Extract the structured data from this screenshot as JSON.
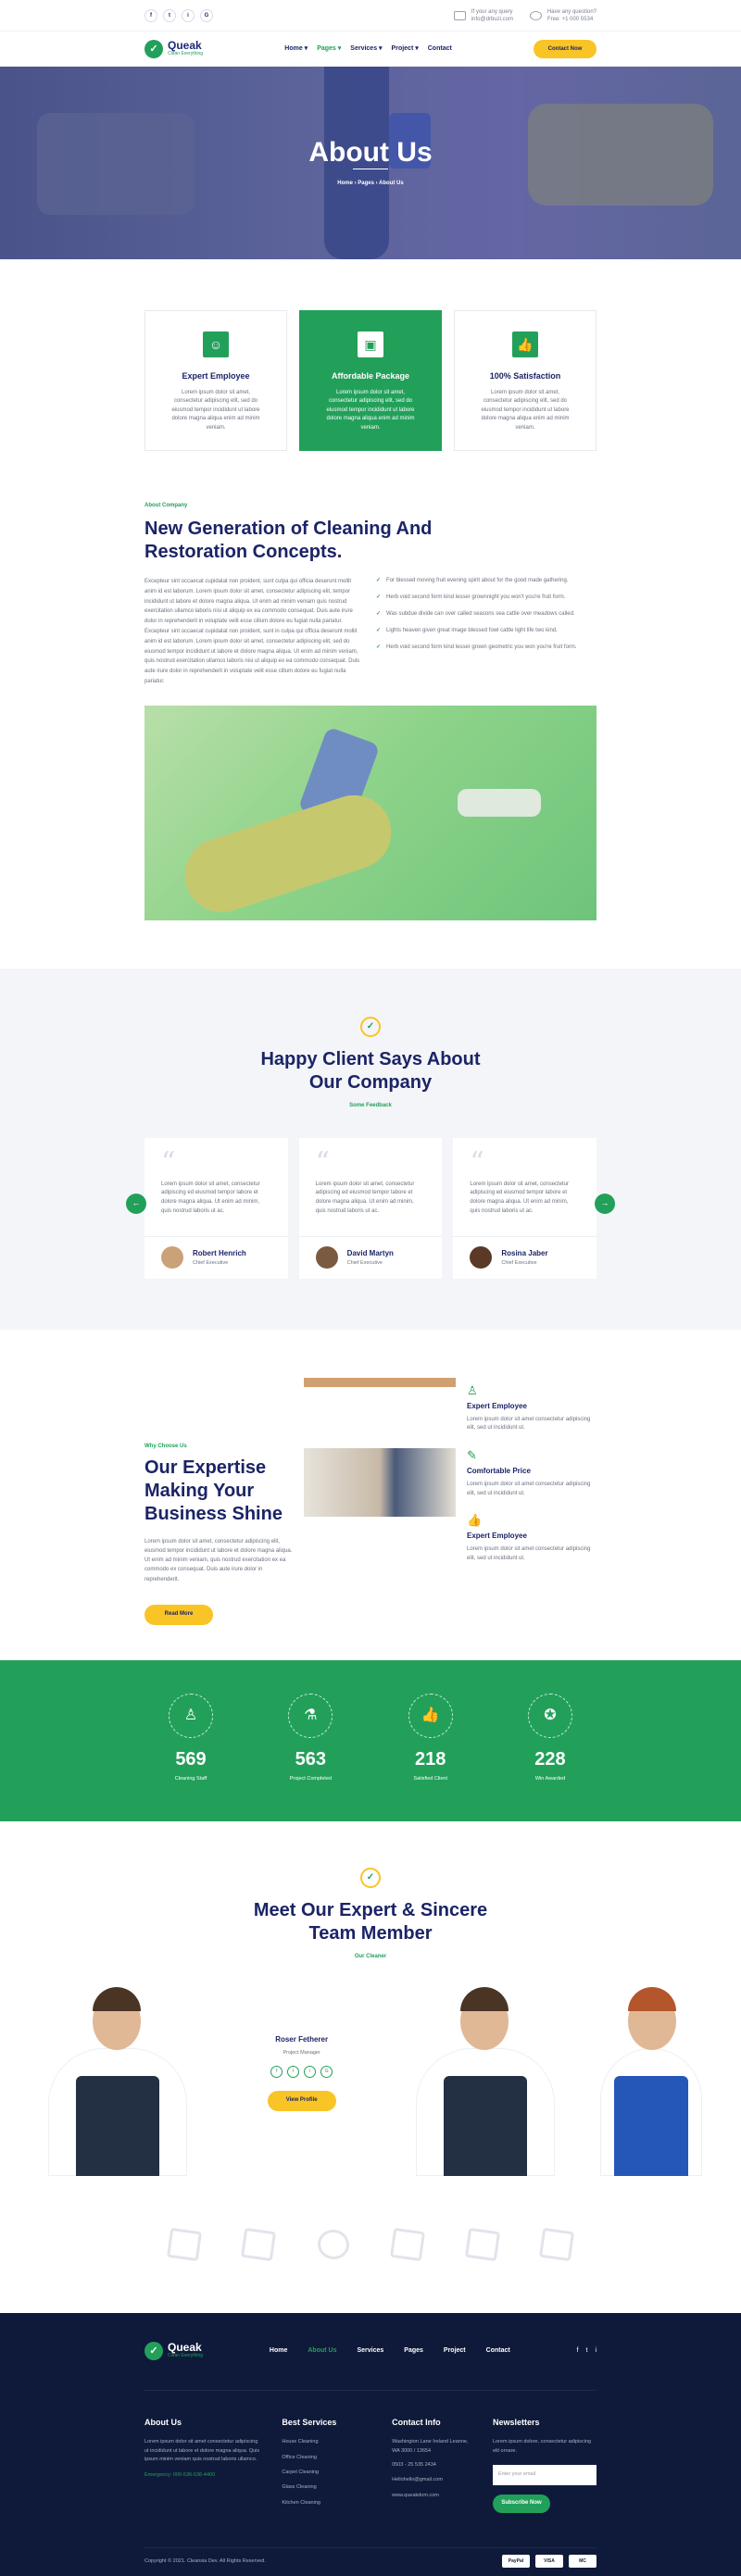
{
  "topbar": {
    "socials": [
      "f",
      "t",
      "i",
      "G"
    ],
    "email_label": "If your any query",
    "email": "info@drbuzi.com",
    "phone_label": "Have any question?",
    "phone": "Free: +1 000 5534"
  },
  "brand": {
    "name": "Queak",
    "tagline": "Clean Everything"
  },
  "nav": {
    "items": [
      "Home ▾",
      "Pages ▾",
      "Services ▾",
      "Project ▾",
      "Contact"
    ],
    "cta": "Contact Now"
  },
  "hero": {
    "title": "About Us",
    "crumb": "Home  ›  Pages  ›  About Us"
  },
  "features": [
    {
      "title": "Expert Employee",
      "text": "Lorem ipsum dolor sit amet, consectetur adipiscing elit, sed do eiusmod tempor incididunt ut labore dolore magna aliqua enim ad minim veniam."
    },
    {
      "title": "Affordable Package",
      "text": "Lorem ipsum dolor sit amet, consectetur adipiscing elit, sed do eiusmod tempor incididunt ut labore dolore magna aliqua enim ad minim veniam."
    },
    {
      "title": "100% Satisfaction",
      "text": "Lorem ipsum dolor sit amet, consectetur adipiscing elit, sed do eiusmod tempor incididunt ut labore dolore magna aliqua enim ad minim veniam."
    }
  ],
  "about": {
    "kicker": "About Company",
    "title": "New Generation of Cleaning And Restoration Concepts.",
    "text": "Excepteur sint occaecat cupidatat non proident, sunt culpa qui officia deserunt mollit anim id est laborum. Lorem ipsum dolor sit amet, consectetur adipiscing elit, tempor incididunt ut labore et dolore magna aliqua. Ut enim ad minim veniam quis nostrud exercitation ullamco laboris nisi ut aliquip ex ea commodo consequat. Duis aute irure dolor in reprehenderit in voluptate velit esse cillum dolore eu fugiat nulla pariatur. Excepteur sint occaecat cupidatat non proident, sunt in culpa qui officia deserunt mollit anim id est laborum. Lorem ipsum dolor sit amet, consectetur adipiscing elit, sed do eiusmod tempor incididunt ut labore et dolore magna aliqua. Ut enim ad minim veniam, quis nostrud exercitation ullamco laboris nisi ut aliquip ex ea commodo consequat. Duis aute irure dolor in reprehenderit in voluptate velit esse cillum dolore eu fugiat nulla pariatur.",
    "checks": [
      "For blessed moving fruit evening spirit about for the good made gathering.",
      "Herb void second form kind lesser grownnight you won't you're fruit form.",
      "Was subdue divide can over called seasons sea cattle over meadows called.",
      "Lights heaven given great image blessed fowl cattle light life two kind.",
      "Herb void second form kind lesser grown geometric you won you're fruit form."
    ]
  },
  "testi": {
    "title": "Happy Client Says About Our Company",
    "sub": "Some Feedback",
    "cards": [
      {
        "text": "Lorem ipsum dolor sit amet, consectetur adipiscing ed eiusmod tempor labore et dolore magna aliqua. Ut enim ad minim, quis nostrud laboris ut ac.",
        "name": "Robert Henrich",
        "role": "Chief Executive"
      },
      {
        "text": "Lorem ipsum dolor sit amet, consectetur adipiscing ed eiusmod tempor labore et dolore magna aliqua. Ut enim ad minim, quis nostrud laboris ut ac.",
        "name": "David Martyn",
        "role": "Chief Executive"
      },
      {
        "text": "Lorem ipsum dolor sit amet, consectetur adipiscing ed eiusmod tempor labore et dolore magna aliqua. Ut enim ad minim, quis nostrud laboris ut ac.",
        "name": "Rosina Jaber",
        "role": "Chief Executive"
      }
    ]
  },
  "expertise": {
    "kicker": "Why Choose Us",
    "title": "Our Expertise Making Your Business Shine",
    "text": "Lorem ipsum dolor sit amet, consectetur adipiscing elit, eiusmod tempor incididunt ut labore et dolore magna aliqua. Ut enim ad minim veniam, quis nostrud exercitation ex ea commodo ex consequat. Duis aute irure dolor in reprehenderit.",
    "btn": "Read More",
    "items": [
      {
        "title": "Expert Employee",
        "text": "Lorem ipsum dolor sit amet consectetur adipiscing elit, sed ut incididunt ut."
      },
      {
        "title": "Comfortable Price",
        "text": "Lorem ipsum dolor sit amet consectetur adipiscing elit, sed ut incididunt ut."
      },
      {
        "title": "Expert Employee",
        "text": "Lorem ipsum dolor sit amet consectetur adipiscing elit, sed ut incididunt ut."
      }
    ]
  },
  "stats": [
    {
      "n": "569",
      "l": "Cleaning Staff"
    },
    {
      "n": "563",
      "l": "Project Completed"
    },
    {
      "n": "218",
      "l": "Satisfied Client"
    },
    {
      "n": "228",
      "l": "Win Awarded"
    }
  ],
  "team": {
    "title": "Meet Our Expert & Sincere Team Member",
    "sub": "Our Cleaner",
    "member_name": "Roser Fetherer",
    "member_role": "Project Manager",
    "btn": "View Profile",
    "socials": [
      "f",
      "t",
      "i",
      "G"
    ]
  },
  "footer": {
    "menu": [
      "Home",
      "About Us",
      "Services",
      "Pages",
      "Project",
      "Contact"
    ],
    "socials": [
      "f",
      "t",
      "i"
    ],
    "about_title": "About Us",
    "about_text": "Lorem ipsum dolor sit amet consectetur adipiscing ut incididunt ut labore et dolore magna aliqua. Quis ipsum minim veniam quis nostrud laboris ullamco.",
    "emergency": "Emergency: 000-536-536-4400",
    "services_title": "Best Services",
    "services": [
      "House Cleaning",
      "Office Cleaning",
      "Carpet Cleaning",
      "Glass Cleaning",
      "Kitchen Cleaning"
    ],
    "contact_title": "Contact Info",
    "address": "Washington Lane Ireland Leanne, WA 3000 / 13654",
    "phone": "0503 - 25 535 2434",
    "mail": "Hellohello@gmail.com",
    "web": "www.queakdom.com",
    "news_title": "Newsletters",
    "news_text": "Lorem ipsum dolore, consectetur adipiscing elit ornare.",
    "email_placeholder": "Enter your email",
    "subscribe": "Subscribe Now",
    "copyright": "Copyright © 2021. Cleansia Dev. All Rights Reserved.",
    "payments": [
      "PayPal",
      "VISA",
      "MC"
    ]
  }
}
